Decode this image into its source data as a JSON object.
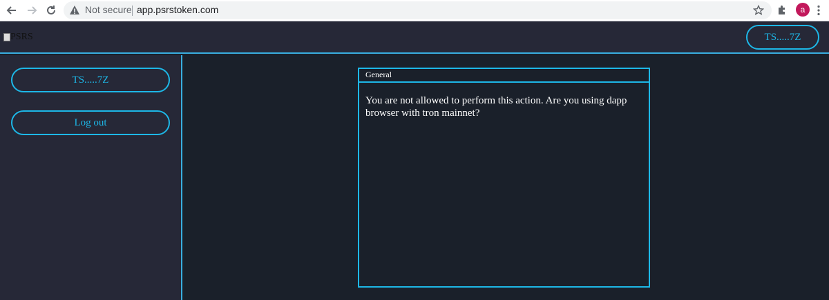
{
  "browser": {
    "security_label": "Not secure",
    "url": "app.psrstoken.com",
    "profile_initial": "a",
    "colors": {
      "profile": "#c2185b"
    }
  },
  "header": {
    "logo_alt": "PSRS",
    "wallet_label": "TS.....7Z"
  },
  "sidebar": {
    "items": [
      {
        "label": "TS.....7Z"
      },
      {
        "label": "Log out"
      }
    ]
  },
  "panel": {
    "title": "General",
    "message": "You are not allowed to perform this action. Are you using dapp browser with tron mainnet?"
  },
  "colors": {
    "accent": "#1db8e8",
    "header_bg": "#262837",
    "main_bg": "#1a202a"
  }
}
